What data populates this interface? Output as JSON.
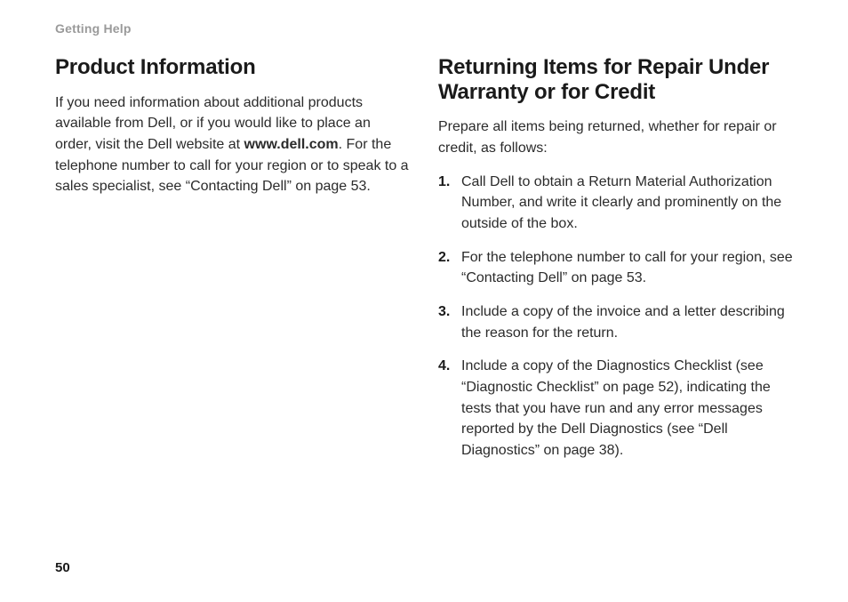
{
  "running_head": "Getting Help",
  "page_number": "50",
  "left": {
    "heading": "Product Information",
    "para_before_bold": "If you need information about additional products available from Dell, or if you would like to place an order, visit the Dell website at ",
    "bold": "www.dell.com",
    "para_after_bold": ". For the telephone number to call for your region or to speak to a sales specialist, see “Contacting Dell” on page 53."
  },
  "right": {
    "heading": "Returning Items for Repair Under Warranty or for Credit",
    "intro": "Prepare all items being returned, whether for repair or credit, as follows:",
    "steps": [
      "Call Dell to obtain a Return Material Authorization Number, and write it clearly and prominently on the outside of the box.",
      "For the telephone number to call for your region, see “Contacting Dell” on page 53.",
      "Include a copy of the invoice and a letter describing the reason for the return.",
      "Include a copy of the Diagnostics Checklist (see “Diagnostic Checklist” on page 52), indicating the tests that you have run and any error messages reported by the Dell Diagnostics (see “Dell Diagnostics” on page 38)."
    ]
  }
}
